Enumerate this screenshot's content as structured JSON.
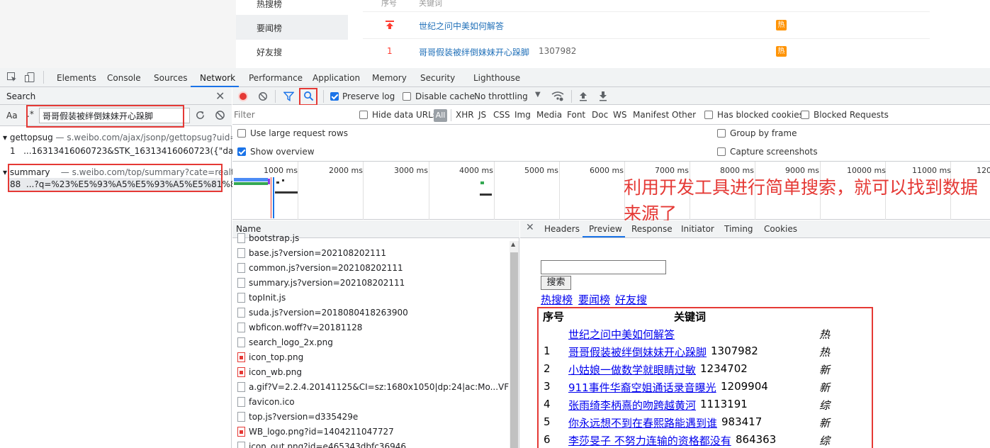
{
  "top_page": {
    "sidebar": [
      "热搜榜",
      "要闻榜",
      "好友搜"
    ],
    "table_header": {
      "rank": "序号",
      "keyword": "关键词"
    },
    "rows": [
      {
        "rank": "",
        "title": "世纪之问中美如何解答",
        "count": "",
        "badge": "热"
      },
      {
        "rank": "1",
        "title": "哥哥假装被绊倒妹妹开心跺脚",
        "count": "1307982",
        "badge": "热"
      }
    ]
  },
  "devtools": {
    "tabs": [
      "Elements",
      "Console",
      "Sources",
      "Network",
      "Performance",
      "Application",
      "Memory",
      "Security",
      "Lighthouse"
    ],
    "active_tab": "Network"
  },
  "search": {
    "title": "Search",
    "aa": "Aa",
    "regex": ".*",
    "query": "哥哥假装被绊倒妹妹开心跺脚",
    "results": [
      {
        "file": "gettopsug",
        "url": "s.weibo.com/ajax/jsonp/gettopsug?uid=&r...",
        "line_no": "1",
        "line": "...16313416060723&STK_16313416060723({\"data\":{\"lis..."
      },
      {
        "file": "summary",
        "url": "s.weibo.com/top/summary?cate=realtimehot",
        "line_no": "88",
        "line": "...?q=%23%E5%93%A5%E5%93%A5%E5%81%87%E..."
      }
    ]
  },
  "toolbar": {
    "preserve_log": "Preserve log",
    "disable_cache": "Disable cache",
    "throttling": "No throttling"
  },
  "filter": {
    "placeholder": "Filter",
    "hide_data_urls": "Hide data URLs",
    "all": "All",
    "types": [
      "XHR",
      "JS",
      "CSS",
      "Img",
      "Media",
      "Font",
      "Doc",
      "WS",
      "Manifest",
      "Other"
    ],
    "has_blocked_cookies": "Has blocked cookies",
    "blocked_requests": "Blocked Requests",
    "use_large_rows": "Use large request rows",
    "show_overview": "Show overview",
    "group_by_frame": "Group by frame",
    "capture_screenshots": "Capture screenshots"
  },
  "overview": {
    "ticks": [
      "1000 ms",
      "2000 ms",
      "3000 ms",
      "4000 ms",
      "5000 ms",
      "6000 ms",
      "7000 ms",
      "8000 ms",
      "9000 ms",
      "10000 ms",
      "11000 ms",
      "120"
    ],
    "annotation": "利用开发工具进行简单搜索，就可以找到数据来源了"
  },
  "requests": {
    "header": "Name",
    "items": [
      {
        "name": "bootstrap.js",
        "kind": "file"
      },
      {
        "name": "base.js?version=202108202111",
        "kind": "file"
      },
      {
        "name": "common.js?version=202108202111",
        "kind": "file"
      },
      {
        "name": "summary.js?version=202108202111",
        "kind": "file"
      },
      {
        "name": "topInit.js",
        "kind": "file"
      },
      {
        "name": "suda.js?version=20180804182639​00",
        "kind": "file"
      },
      {
        "name": "wbficon.woff?v=20181128",
        "kind": "file"
      },
      {
        "name": "search_logo_2x.png",
        "kind": "file"
      },
      {
        "name": "icon_top.png",
        "kind": "img"
      },
      {
        "name": "icon_wb.png",
        "kind": "img"
      },
      {
        "name": "a.gif?V=2.2.4.20141125&CI=sz:1680x1050|dp:24|ac:Mo...VF02fSKMcS...",
        "kind": "file"
      },
      {
        "name": "favicon.ico",
        "kind": "file"
      },
      {
        "name": "top.js?version=d335429e",
        "kind": "file"
      },
      {
        "name": "WB_logo.png?id=1404211047727",
        "kind": "img"
      },
      {
        "name": "icon_out.png?id=e465343dbfc36946",
        "kind": "file"
      }
    ]
  },
  "detail": {
    "tabs": [
      "Headers",
      "Preview",
      "Response",
      "Initiator",
      "Timing",
      "Cookies"
    ],
    "active": "Preview"
  },
  "preview": {
    "search_button": "搜索",
    "links": [
      "热搜榜",
      "要闻榜",
      "好友搜"
    ],
    "header": {
      "rank": "序号",
      "keyword": "关键词"
    },
    "rows": [
      {
        "rank": "",
        "title": "世纪之问中美如何解答",
        "count": "",
        "tag": "热"
      },
      {
        "rank": "1",
        "title": "哥哥假装被绊倒妹妹开心跺脚",
        "count": "1307982",
        "tag": "热"
      },
      {
        "rank": "2",
        "title": "小姑娘一做数学就眼睛过敏",
        "count": "1234702",
        "tag": "新"
      },
      {
        "rank": "3",
        "title": "911事件华裔空姐通话录音曝光",
        "count": "1209904",
        "tag": "新"
      },
      {
        "rank": "4",
        "title": "张雨绮李柄熹的吻跨越黄河",
        "count": "1113191",
        "tag": "综"
      },
      {
        "rank": "5",
        "title": "你永远想不到在春熙路能遇到谁",
        "count": "983417",
        "tag": "新"
      },
      {
        "rank": "6",
        "title": "李莎旻子 不努力连输的资格都没有",
        "count": "864363",
        "tag": "综"
      }
    ]
  },
  "colors": {
    "accent": "#1a73e8",
    "highlight": "#e53935",
    "hot": "#ff9406"
  }
}
